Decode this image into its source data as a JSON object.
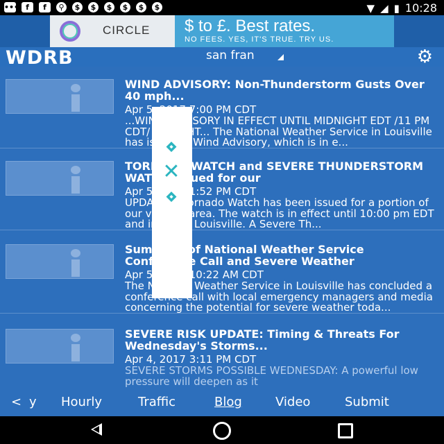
{
  "status_bar": {
    "left_icons": [
      "message-icon",
      "facebook-icon",
      "facebook-icon",
      "keyhole-icon",
      "dollar-icon",
      "dollar-icon",
      "dollar-icon",
      "dollar-icon",
      "dollar-icon",
      "dollar-icon"
    ],
    "time": "10:28"
  },
  "ad": {
    "brand": "CIRCLE",
    "headline": "$ to £. Best rates.",
    "subline": "NO FEES. YES, IT'S TRUE. TRY US."
  },
  "header": {
    "logo": "WDRB",
    "location": "san fran"
  },
  "articles": [
    {
      "title": "WIND ADVISORY: Non-Thunderstorm Gusts Over 40 mph...",
      "date": "Apr 5, 2017 7:00 PM CDT",
      "summary": "...WIND ADVISORY IN EFFECT UNTIL MIDNIGHT EDT /11 PM CDT/ TONIGHT... The National Weather Service in Louisville has issued a Wind Advisory, which is in e..."
    },
    {
      "title": "TORNADO WATCH and SEVERE THUNDERSTORM WATCH Issued for our",
      "date": "Apr 5, 2017 1:52 PM CDT",
      "summary": "UPDATE: A Tornado Watch has been issued for a portion of our viewing area. The watch is in effect until 10:00 pm EDT and includes Louisville. A Severe Th..."
    },
    {
      "title": "Summary of National Weather Service Conference Call and Severe Weather",
      "date": "Apr 5, 2017 10:22 AM CDT",
      "summary": "The National Weather Service in Louisville has concluded a conference call with local emergency managers and media concerning the potential for severe weather toda..."
    },
    {
      "title": "SEVERE RISK UPDATE: Timing & Threats For Wednesday's Storms...",
      "date": "Apr 4, 2017 3:11 PM CDT",
      "summary": "SEVERE STORMS POSSIBLE WEDNESDAY: A powerful low pressure will deepen as it"
    }
  ],
  "tabs": {
    "back_glyph": "<",
    "partial": "y",
    "items": [
      "Hourly",
      "Traffic",
      "Blog",
      "Video",
      "Submit"
    ],
    "active": "Blog"
  },
  "colors": {
    "list_bg": "#2d6fbc",
    "header_bg": "#2a6fbd",
    "ad_right_bg": "#45a5d6"
  }
}
